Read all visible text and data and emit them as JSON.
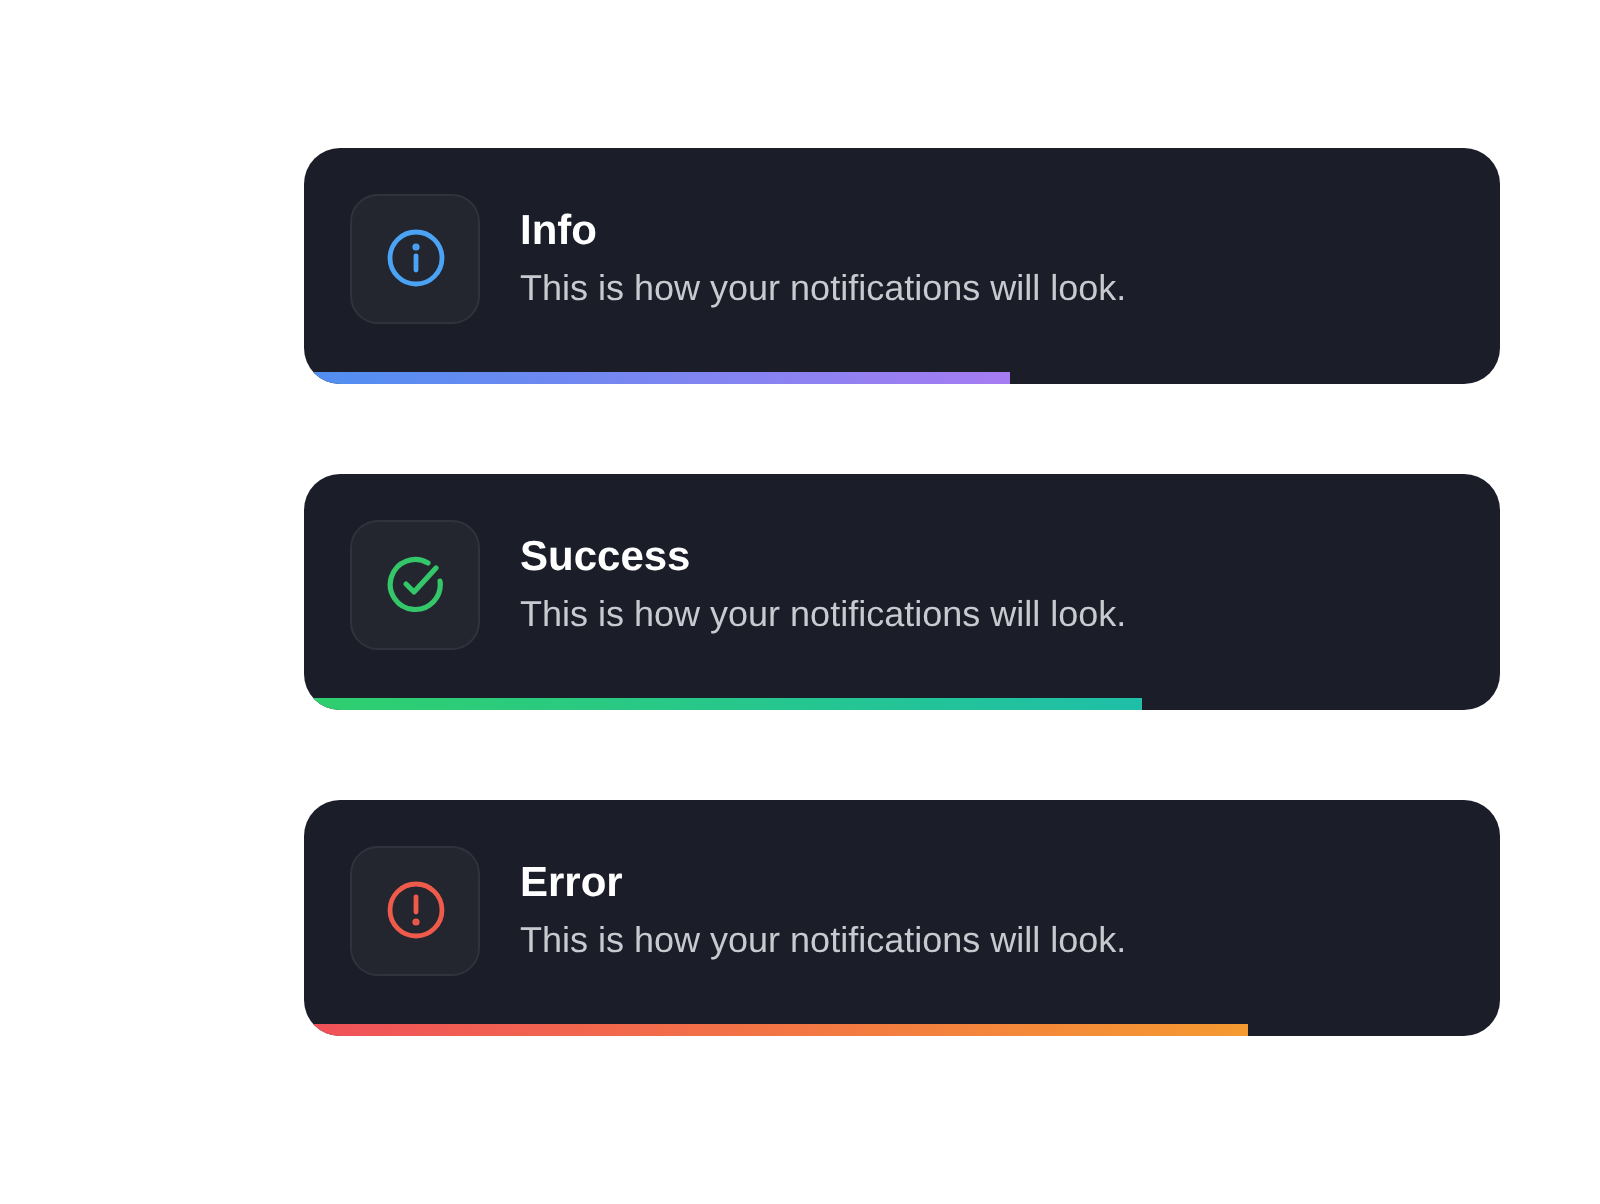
{
  "notifications": [
    {
      "kind": "info",
      "title": "Info",
      "message": "This is how your notifications will look.",
      "level": 0.59
    },
    {
      "kind": "success",
      "title": "Success",
      "message": "This is how your notifications will look.",
      "level": 0.7
    },
    {
      "kind": "error",
      "title": "Error",
      "message": "This is how your notifications will look.",
      "level": 0.79
    }
  ]
}
